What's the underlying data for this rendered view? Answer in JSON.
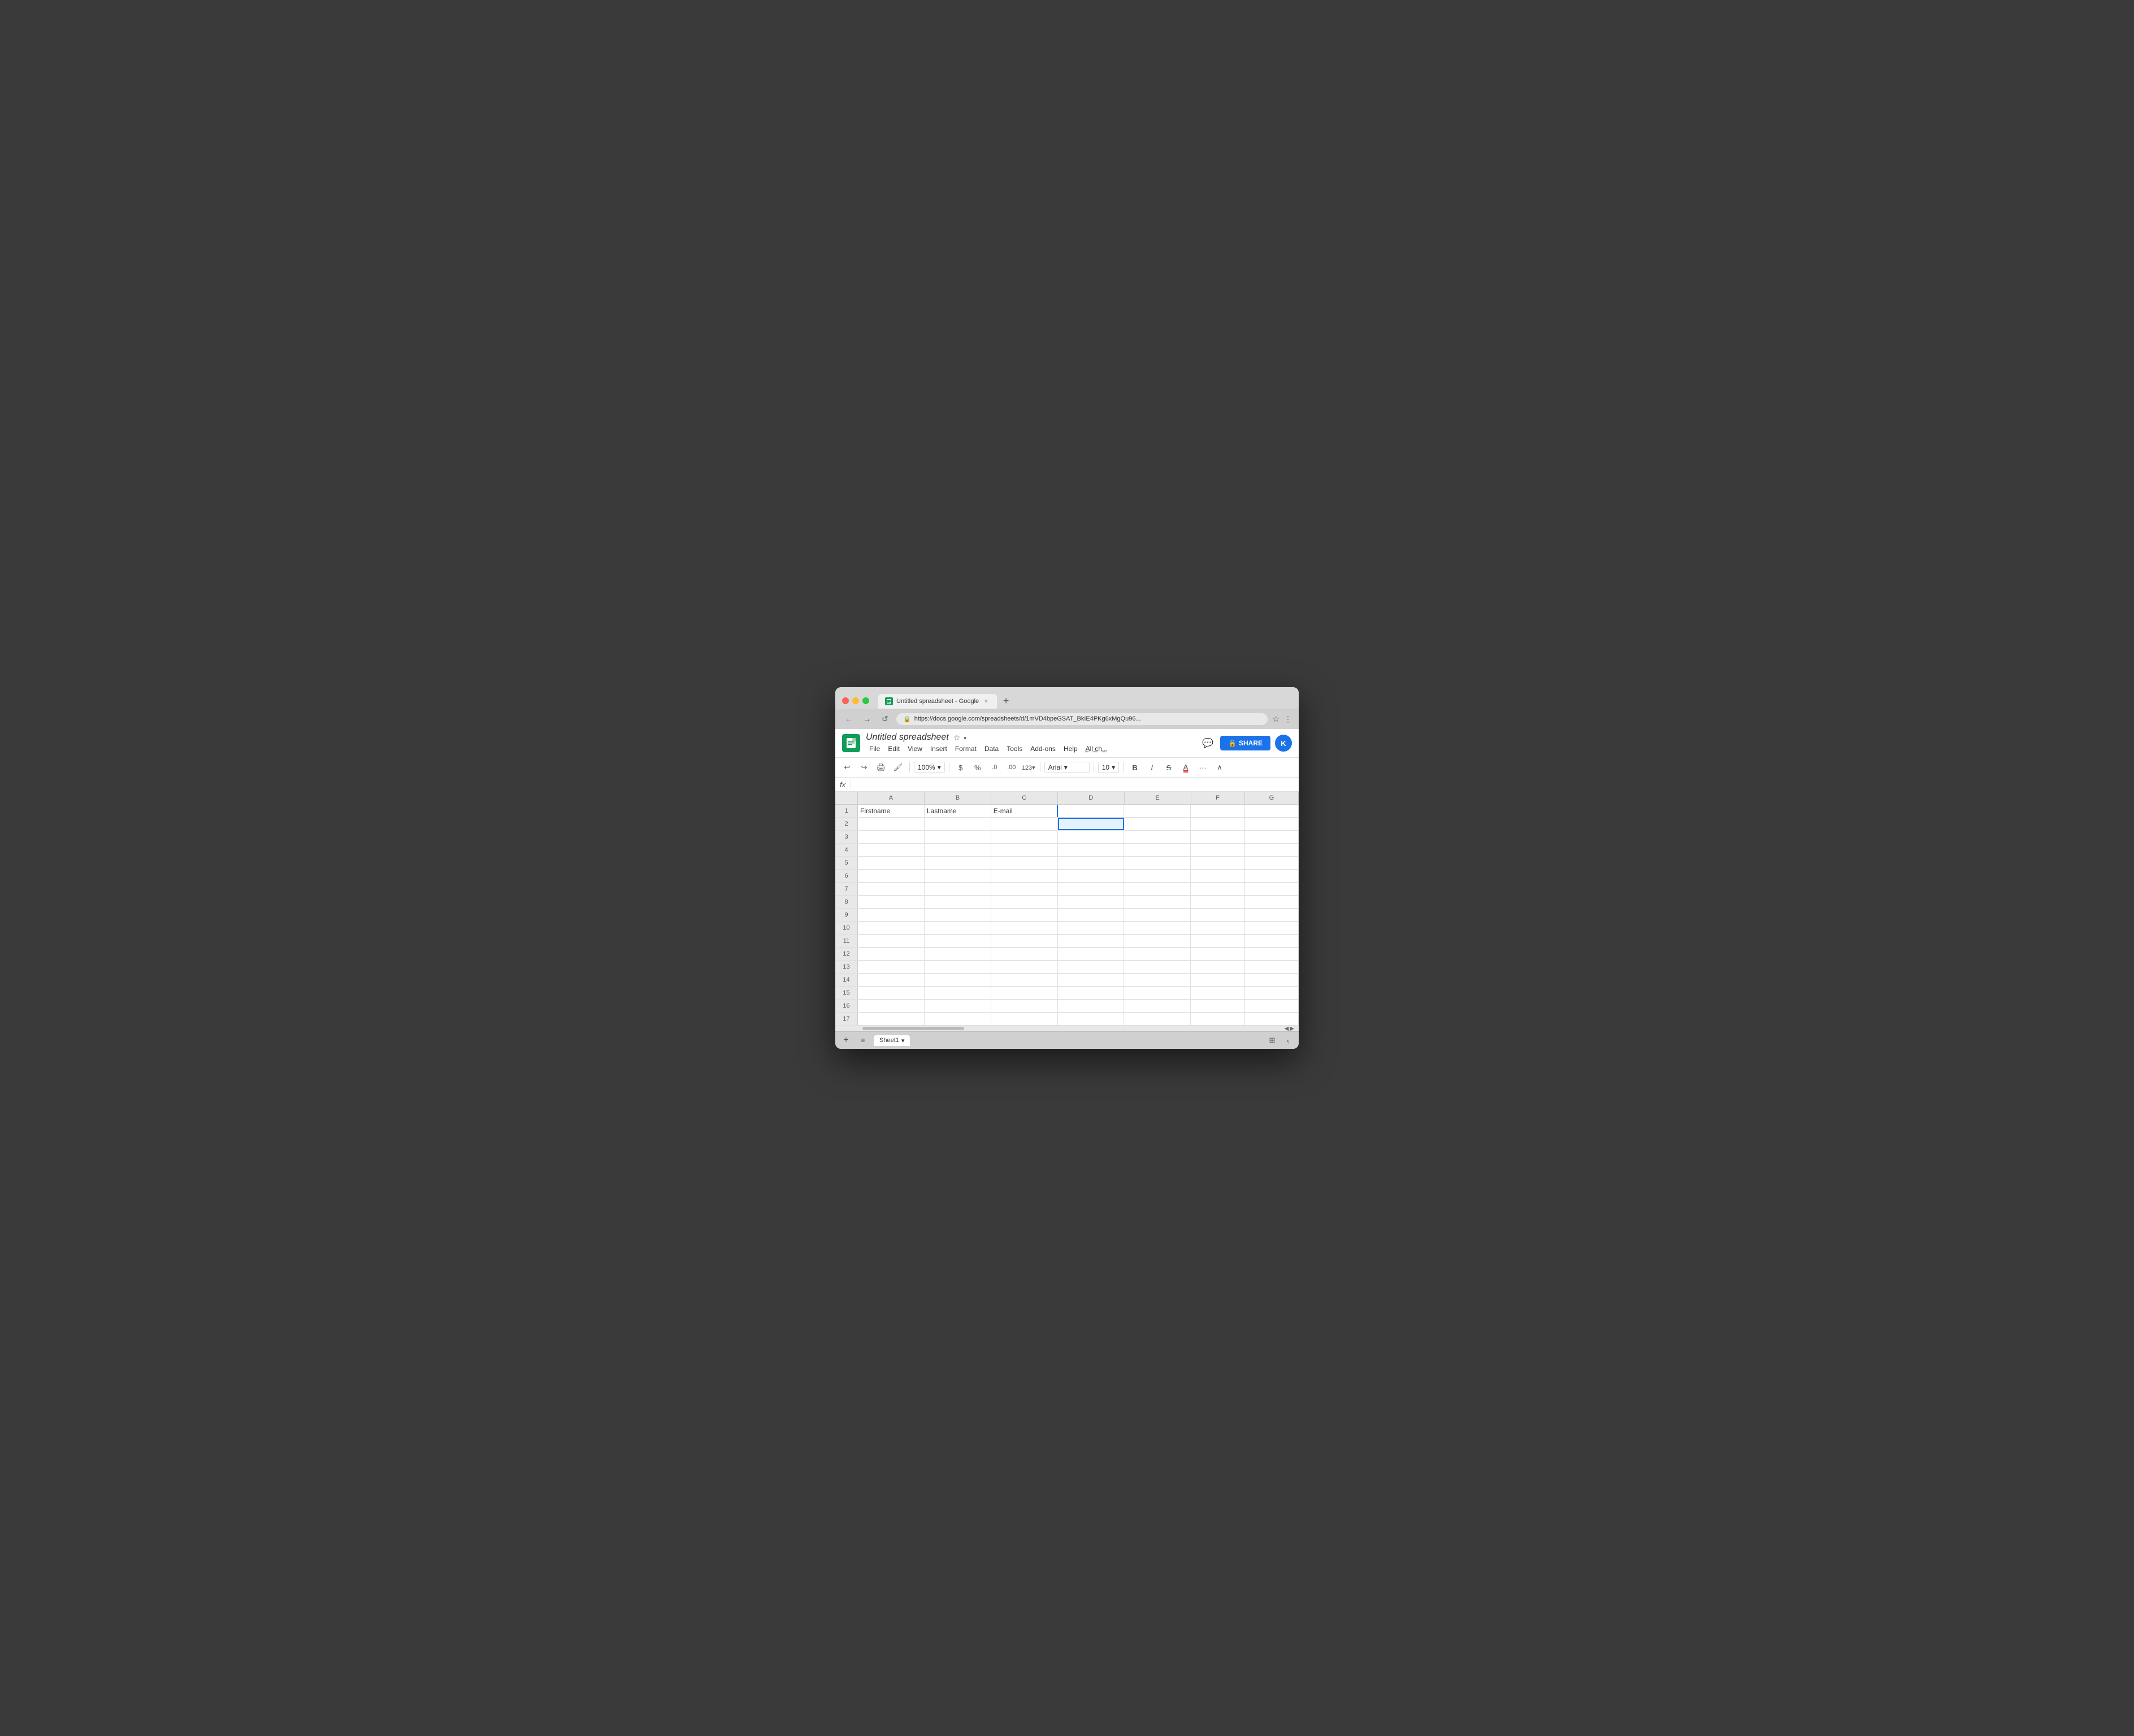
{
  "browser": {
    "tab_title": "Untitled spreadsheet - Google",
    "url": "https://docs.google.com/spreadsheets/d/1mVD4bpeGSAT_BkIE4PKg6xMgQu96...",
    "new_tab_label": "+"
  },
  "app": {
    "title": "Untitled spreadsheet",
    "logo_alt": "Google Sheets",
    "share_label": "SHARE",
    "avatar_label": "K"
  },
  "menu": {
    "items": [
      "File",
      "Edit",
      "View",
      "Insert",
      "Format",
      "Data",
      "Tools",
      "Add-ons",
      "Help",
      "All ch..."
    ]
  },
  "toolbar": {
    "undo": "↩",
    "redo": "↪",
    "print": "⊟",
    "paint": "⊘",
    "zoom": "100%",
    "currency": "$",
    "percent": "%",
    "decimal_less": ".0",
    "decimal_more": ".00",
    "number_format": "123",
    "font": "Arial",
    "font_size": "10",
    "bold": "B",
    "italic": "I",
    "strikethrough": "S",
    "font_color": "A",
    "more": "···",
    "collapse": "∧"
  },
  "formula_bar": {
    "fx_label": "fx"
  },
  "columns": {
    "headers": [
      "A",
      "B",
      "C",
      "D",
      "E",
      "F",
      "G"
    ],
    "widths": [
      130,
      130,
      130,
      130,
      130,
      105,
      105
    ]
  },
  "rows": [
    {
      "num": 1,
      "cells": [
        "Firstname",
        "Lastname",
        "E-mail",
        "",
        "",
        "",
        ""
      ]
    },
    {
      "num": 2,
      "cells": [
        "",
        "",
        "",
        "",
        "",
        "",
        ""
      ]
    },
    {
      "num": 3,
      "cells": [
        "",
        "",
        "",
        "",
        "",
        "",
        ""
      ]
    },
    {
      "num": 4,
      "cells": [
        "",
        "",
        "",
        "",
        "",
        "",
        ""
      ]
    },
    {
      "num": 5,
      "cells": [
        "",
        "",
        "",
        "",
        "",
        "",
        ""
      ]
    },
    {
      "num": 6,
      "cells": [
        "",
        "",
        "",
        "",
        "",
        "",
        ""
      ]
    },
    {
      "num": 7,
      "cells": [
        "",
        "",
        "",
        "",
        "",
        "",
        ""
      ]
    },
    {
      "num": 8,
      "cells": [
        "",
        "",
        "",
        "",
        "",
        "",
        ""
      ]
    },
    {
      "num": 9,
      "cells": [
        "",
        "",
        "",
        "",
        "",
        "",
        ""
      ]
    },
    {
      "num": 10,
      "cells": [
        "",
        "",
        "",
        "",
        "",
        "",
        ""
      ]
    },
    {
      "num": 11,
      "cells": [
        "",
        "",
        "",
        "",
        "",
        "",
        ""
      ]
    },
    {
      "num": 12,
      "cells": [
        "",
        "",
        "",
        "",
        "",
        "",
        ""
      ]
    },
    {
      "num": 13,
      "cells": [
        "",
        "",
        "",
        "",
        "",
        "",
        ""
      ]
    },
    {
      "num": 14,
      "cells": [
        "",
        "",
        "",
        "",
        "",
        "",
        ""
      ]
    },
    {
      "num": 15,
      "cells": [
        "",
        "",
        "",
        "",
        "",
        "",
        ""
      ]
    },
    {
      "num": 16,
      "cells": [
        "",
        "",
        "",
        "",
        "",
        "",
        ""
      ]
    },
    {
      "num": 17,
      "cells": [
        "",
        "",
        "",
        "",
        "",
        "",
        ""
      ]
    }
  ],
  "selected_cell": {
    "row": 2,
    "col": 3
  },
  "bottom": {
    "add_sheet": "+",
    "sheet_list": "≡",
    "sheet_name": "Sheet1",
    "sheet_dropdown": "▾",
    "explore_icon": "⊞",
    "collapse_icon": "‹"
  }
}
